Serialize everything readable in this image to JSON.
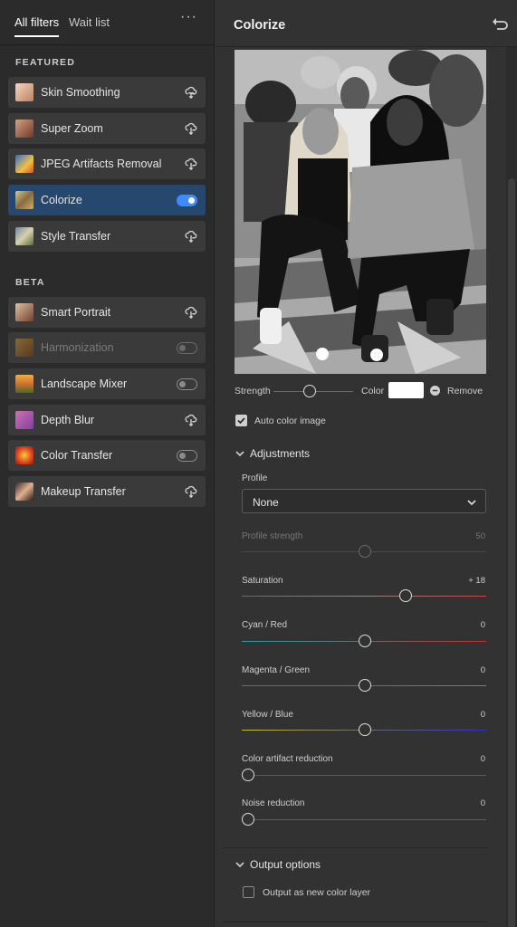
{
  "tabs": {
    "all_filters": "All filters",
    "wait_list": "Wait list",
    "more": "···"
  },
  "featured_label": "FEATURED",
  "beta_label": "BETA",
  "featured": [
    {
      "label": "Skin Smoothing",
      "control": "cloud-download"
    },
    {
      "label": "Super Zoom",
      "control": "cloud-download"
    },
    {
      "label": "JPEG Artifacts Removal",
      "control": "cloud-download"
    },
    {
      "label": "Colorize",
      "control": "toggle-on",
      "selected": true
    },
    {
      "label": "Style Transfer",
      "control": "cloud-download"
    }
  ],
  "beta": [
    {
      "label": "Smart Portrait",
      "control": "cloud-download"
    },
    {
      "label": "Harmonization",
      "control": "toggle-off",
      "disabled": true
    },
    {
      "label": "Landscape Mixer",
      "control": "toggle-off"
    },
    {
      "label": "Depth Blur",
      "control": "cloud-download"
    },
    {
      "label": "Color Transfer",
      "control": "toggle-off"
    },
    {
      "label": "Makeup Transfer",
      "control": "cloud-download"
    }
  ],
  "panel": {
    "title": "Colorize",
    "strength_label": "Strength",
    "color_label": "Color",
    "remove_label": "Remove",
    "auto_color_label": "Auto color image",
    "auto_color_checked": true,
    "adjustments_label": "Adjustments",
    "profile_label": "Profile",
    "profile_value": "None",
    "output_options_label": "Output options",
    "output_new_layer_label": "Output as new color layer",
    "output_new_layer_checked": false
  },
  "sliders": [
    {
      "label": "Profile strength",
      "value": "50",
      "disabled": true
    },
    {
      "label": "Saturation",
      "value": "+ 18"
    },
    {
      "label": "Cyan / Red",
      "value": "0"
    },
    {
      "label": "Magenta / Green",
      "value": "0"
    },
    {
      "label": "Yellow / Blue",
      "value": "0"
    },
    {
      "label": "Color artifact reduction",
      "value": "0"
    },
    {
      "label": "Noise reduction",
      "value": "0"
    }
  ],
  "colors": {
    "accent": "#3d8bff",
    "selected_row": "#26476e",
    "panel_bg": "#323232",
    "left_bg": "#2b2b2b"
  }
}
